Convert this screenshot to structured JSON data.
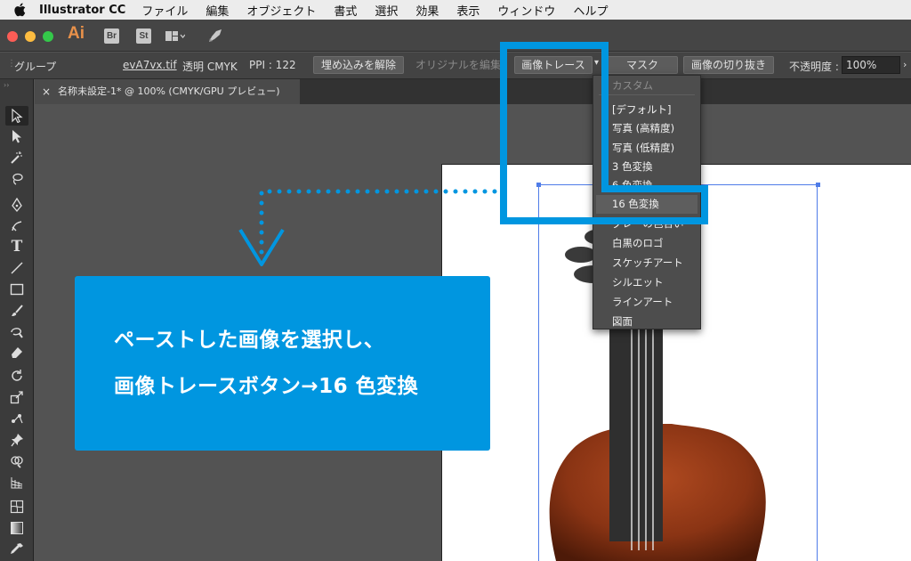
{
  "menubar": {
    "app_name": "Illustrator CC",
    "items": [
      "ファイル",
      "編集",
      "オブジェクト",
      "書式",
      "選択",
      "効果",
      "表示",
      "ウィンドウ",
      "ヘルプ"
    ]
  },
  "appbar": {
    "logo": "Ai",
    "bridge_label": "Br",
    "stock_label": "St"
  },
  "control_bar": {
    "group_label": "グループ",
    "file_link": "evA7vx.tif",
    "transparency_info": "透明 CMYK",
    "ppi_info": "PPI : 122",
    "unembed_button": "埋め込みを解除",
    "edit_original_button": "オリジナルを編集",
    "image_trace_button": "画像トレース",
    "mask_button": "マスク",
    "crop_button": "画像の切り抜き",
    "opacity_label": "不透明度 :",
    "opacity_value": "100%"
  },
  "document_tab": {
    "title": "名称未設定-1* @ 100% (CMYK/GPU プレビュー)"
  },
  "trace_menu": {
    "header": "カスタム",
    "items": [
      "[デフォルト]",
      "写真 (高精度)",
      "写真 (低精度)",
      "3 色変換",
      "6 色変換",
      "16 色変換",
      "グレーの色合い",
      "白黒のロゴ",
      "スケッチアート",
      "シルエット",
      "ラインアート",
      "図面"
    ],
    "selected_index": 5
  },
  "callout": {
    "line1": "ペーストした画像を選択し、",
    "line2": "画像トレースボタン→16 色変換"
  },
  "colors": {
    "accent_blue": "#0096e0",
    "selection_blue": "#4f7ce8",
    "close_red": "#fc5d56",
    "minimize_yellow": "#fdbc40",
    "zoom_green": "#34c84a"
  }
}
